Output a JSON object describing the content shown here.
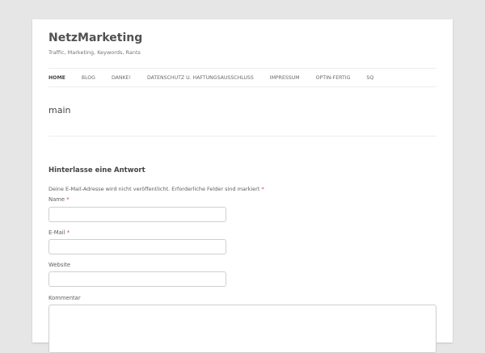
{
  "site": {
    "title": "NetzMarketing",
    "description": "Traffic, Marketing, Keywords, Rants"
  },
  "nav": {
    "items": [
      {
        "label": "HOME",
        "current": true
      },
      {
        "label": "BLOG"
      },
      {
        "label": "DANKE!"
      },
      {
        "label": "DATENSCHUTZ U. HAFTUNGSAUSSCHLUSS"
      },
      {
        "label": "IMPRESSUM"
      },
      {
        "label": "OPTIN-FERTIG"
      },
      {
        "label": "SQ"
      }
    ]
  },
  "entry": {
    "title": "main"
  },
  "comment_form": {
    "title": "Hinterlasse eine Antwort",
    "notes": "Deine E-Mail-Adresse wird nicht veröffentlicht. Erforderliche Felder sind markiert",
    "required_marker": "*",
    "fields": {
      "name_label": "Name",
      "email_label": "E-Mail",
      "website_label": "Website",
      "comment_label": "Kommentar",
      "name_value": "",
      "email_value": "",
      "website_value": ""
    }
  },
  "colors": {
    "background": "#e6e6e6",
    "page": "#ffffff",
    "required": "#b94a48",
    "divider": "#ededed"
  }
}
